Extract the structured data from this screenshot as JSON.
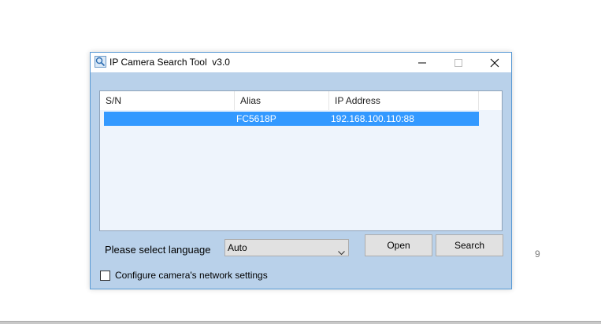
{
  "window": {
    "title": "IP Camera Search Tool  v3.0",
    "controls": {
      "minimize_icon": "minimize-icon",
      "maximize_icon": "maximize-icon",
      "close_icon": "close-icon"
    },
    "app_icon": "magnifier-icon"
  },
  "device_list": {
    "columns": [
      "S/N",
      "Alias",
      "IP Address"
    ],
    "rows": [
      {
        "sn": "",
        "alias": "FC5618P",
        "ip": "192.168.100.110:88",
        "selected": true
      }
    ],
    "selection_color": "#3399ff"
  },
  "language": {
    "label": "Please select language",
    "selected": "Auto"
  },
  "buttons": {
    "open": "Open",
    "search": "Search"
  },
  "network_settings": {
    "label": "Configure camera's network settings",
    "checked": false
  },
  "page_number": "9",
  "colors": {
    "window_background": "#b9d1ea",
    "window_border": "#5b9bd5",
    "list_background": "#eef4fc"
  }
}
